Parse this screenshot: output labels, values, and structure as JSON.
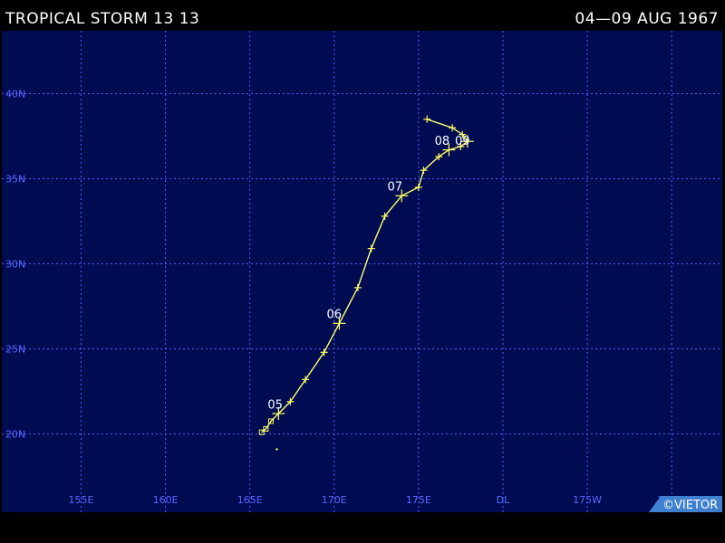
{
  "header": {
    "storm_title": "TROPICAL STORM 13 13",
    "date_range": "04—09 AUG 1967"
  },
  "map": {
    "background_color": "#000c52",
    "grid_color": "#4d5fff",
    "track_color": "#ffff66",
    "lat_labels": [
      "40N",
      "35N",
      "30N",
      "25N",
      "20N"
    ],
    "lon_labels": [
      "155E",
      "160E",
      "165E",
      "170E",
      "175E",
      "DL",
      "175W",
      "170W"
    ],
    "lat_values": [
      40,
      35,
      30,
      25,
      20
    ],
    "lon_values": [
      155,
      160,
      165,
      170,
      175,
      180,
      185,
      190
    ],
    "lat_range": [
      15.4,
      43.7
    ],
    "lon_range": [
      150.3,
      193.0
    ]
  },
  "track": {
    "points": [
      {
        "lon": 165.7,
        "lat": 20.1
      },
      {
        "lon": 165.95,
        "lat": 20.3
      },
      {
        "lon": 166.25,
        "lat": 20.75
      },
      {
        "lon": 166.7,
        "lat": 21.2
      },
      {
        "lon": 167.4,
        "lat": 21.9
      },
      {
        "lon": 168.3,
        "lat": 23.2
      },
      {
        "lon": 169.4,
        "lat": 24.8
      },
      {
        "lon": 170.3,
        "lat": 26.5
      },
      {
        "lon": 171.4,
        "lat": 28.6
      },
      {
        "lon": 172.2,
        "lat": 30.9
      },
      {
        "lon": 173.0,
        "lat": 32.8
      },
      {
        "lon": 174.0,
        "lat": 34.0
      },
      {
        "lon": 175.0,
        "lat": 34.5
      },
      {
        "lon": 175.3,
        "lat": 35.5
      },
      {
        "lon": 176.2,
        "lat": 36.3
      },
      {
        "lon": 176.8,
        "lat": 36.7
      },
      {
        "lon": 177.5,
        "lat": 36.9
      },
      {
        "lon": 177.9,
        "lat": 37.2
      },
      {
        "lon": 177.6,
        "lat": 37.6
      },
      {
        "lon": 177.0,
        "lat": 38.0
      },
      {
        "lon": 175.5,
        "lat": 38.5
      }
    ],
    "large_markers": [
      3,
      7,
      11,
      15,
      17
    ],
    "small_markers": [
      4,
      5,
      6,
      8,
      9,
      10,
      12,
      13,
      14,
      16,
      18,
      19,
      20
    ],
    "square_markers": [
      0,
      1,
      2
    ],
    "stray_dot": {
      "lon": 166.6,
      "lat": 19.1
    },
    "day_labels": [
      {
        "text": "05",
        "lon": 166.5,
        "lat": 21.5
      },
      {
        "text": "06",
        "lon": 170.0,
        "lat": 26.8
      },
      {
        "text": "07",
        "lon": 173.6,
        "lat": 34.3
      },
      {
        "text": "08",
        "lon": 176.4,
        "lat": 37.0
      },
      {
        "text": "09",
        "lon": 177.6,
        "lat": 37.0
      }
    ]
  },
  "credit": {
    "text": "©VIETOR",
    "background": "#3f7fcf"
  }
}
